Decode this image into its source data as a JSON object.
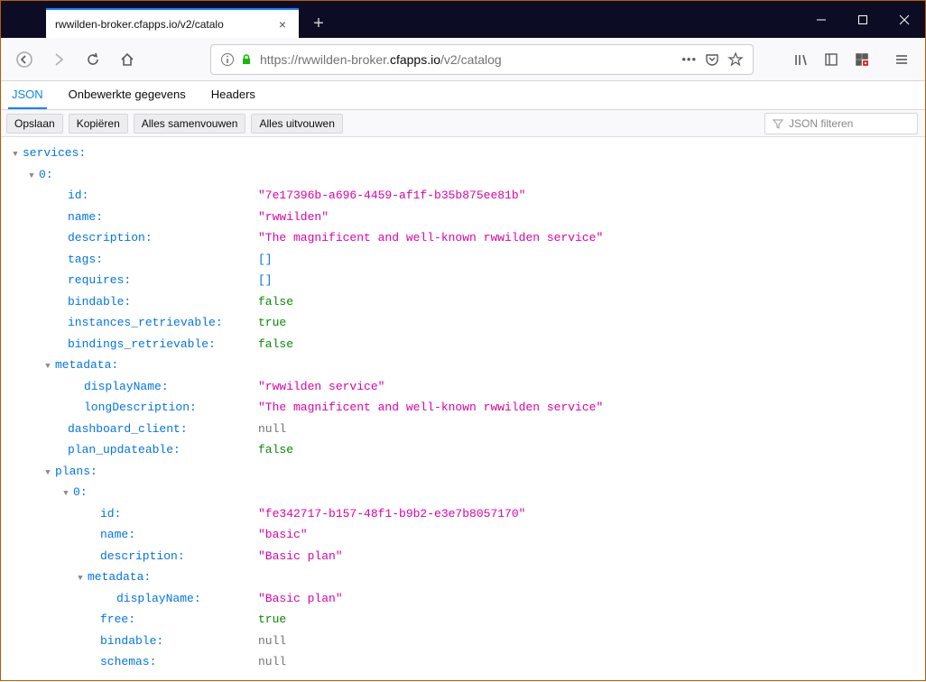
{
  "browser": {
    "tab_title": "rwwilden-broker.cfapps.io/v2/catalo",
    "url_prefix": "https://rwwilden-broker.",
    "url_host": "cfapps.io",
    "url_path": "/v2/catalog",
    "filter_placeholder": "JSON filteren"
  },
  "viewtabs": {
    "json": "JSON",
    "raw": "Onbewerkte gegevens",
    "headers": "Headers"
  },
  "toolbar": {
    "save": "Opslaan",
    "copy": "Kopiëren",
    "collapse": "Alles samenvouwen",
    "expand": "Alles uitvouwen"
  },
  "json": {
    "services_key": "services",
    "idx0": "0",
    "id_key": "id",
    "id_val": "\"7e17396b-a696-4459-af1f-b35b875ee81b\"",
    "name_key": "name",
    "name_val": "\"rwwilden\"",
    "desc_key": "description",
    "desc_val": "\"The magnificent and well-known rwwilden service\"",
    "tags_key": "tags",
    "tags_val": "[]",
    "requires_key": "requires",
    "requires_val": "[]",
    "bindable_key": "bindable",
    "bindable_val": "false",
    "inst_retr_key": "instances_retrievable",
    "inst_retr_val": "true",
    "bind_retr_key": "bindings_retrievable",
    "bind_retr_val": "false",
    "metadata_key": "metadata",
    "displayName_key": "displayName",
    "displayName_val": "\"rwwilden service\"",
    "longDesc_key": "longDescription",
    "longDesc_val": "\"The magnificent and well-known rwwilden service\"",
    "dash_key": "dashboard_client",
    "dash_val": "null",
    "planupd_key": "plan_updateable",
    "planupd_val": "false",
    "plans_key": "plans",
    "p_id_key": "id",
    "p_id_val": "\"fe342717-b157-48f1-b9b2-e3e7b8057170\"",
    "p_name_key": "name",
    "p_name_val": "\"basic\"",
    "p_desc_key": "description",
    "p_desc_val": "\"Basic plan\"",
    "p_meta_key": "metadata",
    "p_disp_key": "displayName",
    "p_disp_val": "\"Basic plan\"",
    "p_free_key": "free",
    "p_free_val": "true",
    "p_bind_key": "bindable",
    "p_bind_val": "null",
    "p_schemas_key": "schemas",
    "p_schemas_val": "null"
  }
}
